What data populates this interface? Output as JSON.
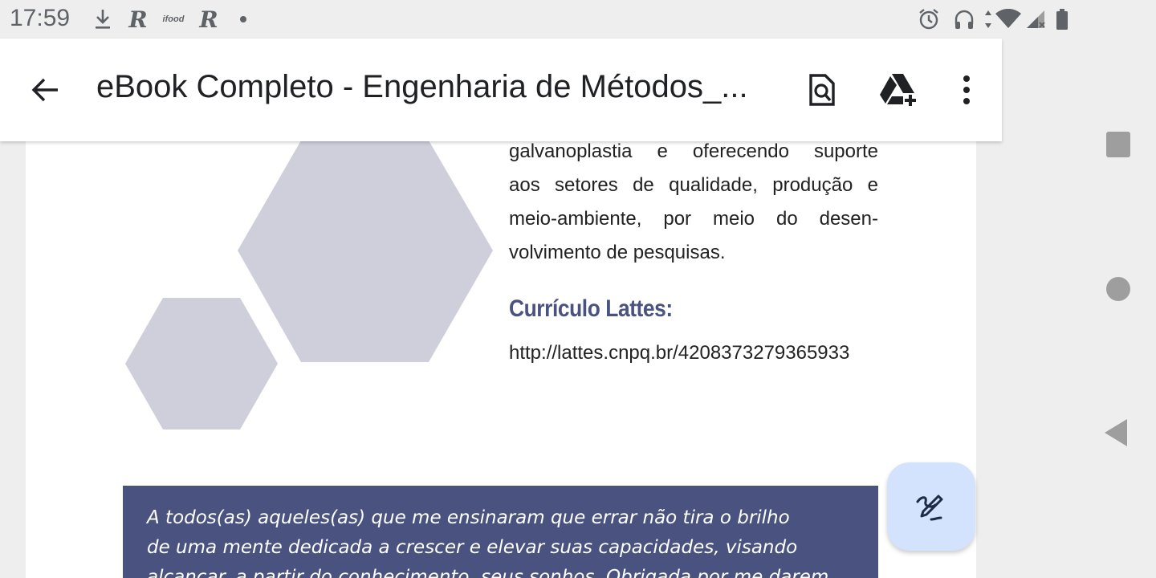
{
  "status_bar": {
    "time": "17:59",
    "left_icons": [
      "download-icon",
      "r-app-icon",
      "ifood-icon",
      "r-app-icon",
      "dot-icon"
    ],
    "ifood_label": "ifood",
    "r_label": "R",
    "right_icons": [
      "alarm-icon",
      "headphones-icon",
      "data-arrows-icon",
      "wifi-icon",
      "signal-icon",
      "battery-icon"
    ]
  },
  "app_bar": {
    "title": "eBook Completo - Engenharia de Métodos_...",
    "actions": [
      "search-in-document-icon",
      "add-to-drive-icon",
      "more-vert-icon"
    ]
  },
  "document": {
    "body_lines": [
      "galvanoplastia e oferecendo suporte",
      "aos setores de qualidade, produção e",
      "meio-ambiente, por meio do desen-",
      "volvimento de pesquisas."
    ],
    "heading": "Currículo Lattes:",
    "url": "http://lattes.cnpq.br/4208373279365933",
    "dedication_lines": [
      "A todos(as) aqueles(as) que me ensinaram que errar não tira o brilho",
      "de uma mente dedicada a crescer e elevar suas capacidades, visando",
      "alcançar, a partir do conhecimento, seus sonhos. Obrigada por me darem"
    ]
  },
  "fab": {
    "icon": "annotate-pen-icon"
  },
  "nav": {
    "buttons": [
      "recents-square-icon",
      "home-circle-icon",
      "back-triangle-icon"
    ]
  },
  "colors": {
    "hexagon": "#cfcedb",
    "accent": "#4a5380",
    "fab_background": "#d3e3fd"
  }
}
